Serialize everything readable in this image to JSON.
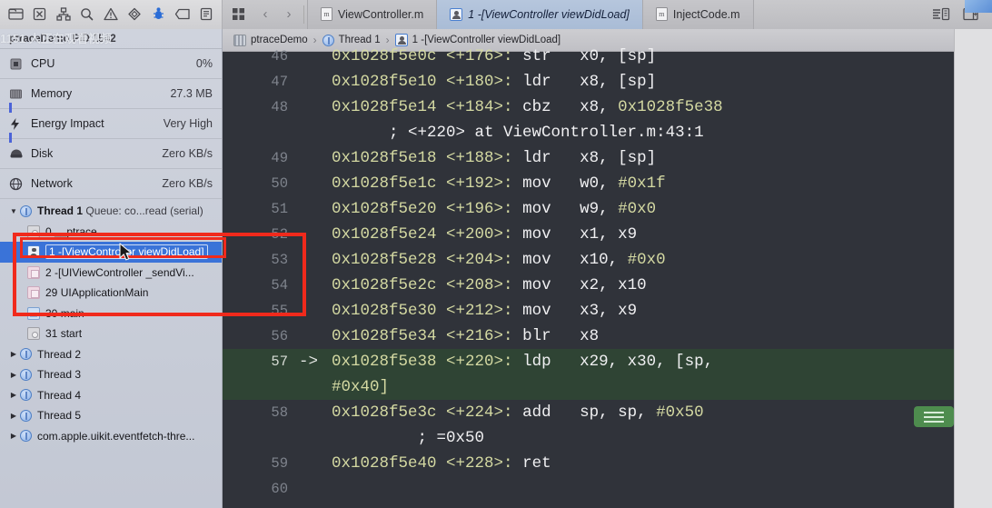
{
  "toolbar": {
    "nav_icons": [
      {
        "name": "project-navigator-icon",
        "glyph": "folder"
      },
      {
        "name": "source-control-navigator-icon",
        "glyph": "xbox"
      },
      {
        "name": "symbol-navigator-icon",
        "glyph": "hierarchy"
      },
      {
        "name": "find-navigator-icon",
        "glyph": "search"
      },
      {
        "name": "issue-navigator-icon",
        "glyph": "warning"
      },
      {
        "name": "test-navigator-icon",
        "glyph": "diamond"
      },
      {
        "name": "debug-navigator-icon",
        "glyph": "debug"
      },
      {
        "name": "breakpoint-navigator-icon",
        "glyph": "tag"
      },
      {
        "name": "report-navigator-icon",
        "glyph": "report"
      }
    ],
    "jump_bar_grid": "grid-icon",
    "back_arrow": "‹",
    "forward_arrow": "›",
    "tabs": [
      {
        "label": "ViewController.m",
        "icon": "m",
        "active": false
      },
      {
        "label": "1 -[ViewController viewDidLoad]",
        "icon": "frame",
        "active": true
      },
      {
        "label": "InjectCode.m",
        "icon": "m",
        "active": false
      }
    ],
    "right_buttons": [
      {
        "name": "assistant-editor-button",
        "label": "≡"
      },
      {
        "name": "inspector-toggle-button",
        "label": "▣"
      }
    ]
  },
  "sidebar": {
    "header": {
      "process": "ptraceDemo PID 1542",
      "watermark": "1151 人正在观看视频"
    },
    "gauges": [
      {
        "name": "cpu",
        "label": "CPU",
        "value": "0%",
        "icon": "cpu-icon",
        "spark": false
      },
      {
        "name": "memory",
        "label": "Memory",
        "value": "27.3 MB",
        "icon": "memory-icon",
        "spark": true
      },
      {
        "name": "energy",
        "label": "Energy Impact",
        "value": "Very High",
        "icon": "energy-icon",
        "spark": true
      },
      {
        "name": "disk",
        "label": "Disk",
        "value": "Zero KB/s",
        "icon": "disk-icon",
        "spark": false
      },
      {
        "name": "network",
        "label": "Network",
        "value": "Zero KB/s",
        "icon": "network-icon",
        "spark": false
      }
    ],
    "thread1": {
      "disclosure": "▼",
      "name": "Thread 1",
      "queue": "Queue: co...read (serial)"
    },
    "frames": [
      {
        "index": "0",
        "label": "__ptrace",
        "icon": "gray",
        "selected": false
      },
      {
        "index": "1",
        "label": "-[ViewController viewDidLoad]",
        "icon": "usr",
        "selected": true
      },
      {
        "index": "2",
        "label": "-[UIViewController _sendVi...",
        "icon": "pink",
        "selected": false
      },
      {
        "index": "29",
        "label": "UIApplicationMain",
        "icon": "pink",
        "selected": false
      },
      {
        "index": "30",
        "label": "main",
        "icon": "blue",
        "selected": false
      },
      {
        "index": "31",
        "label": "start",
        "icon": "gray",
        "selected": false
      }
    ],
    "other_threads": [
      {
        "disclosure": "▶",
        "name": "Thread 2",
        "queue": ""
      },
      {
        "disclosure": "▶",
        "name": "Thread 3",
        "queue": ""
      },
      {
        "disclosure": "▶",
        "name": "Thread 4",
        "queue": ""
      },
      {
        "disclosure": "▶",
        "name": "Thread 5",
        "queue": ""
      },
      {
        "disclosure": "▶",
        "name": "com.apple.uikit.eventfetch-thre...",
        "queue": ""
      }
    ]
  },
  "breadcrumb": {
    "project": "ptraceDemo",
    "thread": "Thread 1",
    "frame": "1 -[ViewController viewDidLoad]",
    "sep": "›"
  },
  "editor": {
    "assembly_badge": "assembly-toggle-badge",
    "lines": [
      {
        "num": "46",
        "ptr": "",
        "addr": "0x1028f5e0c",
        "off": "<+176>:",
        "mnem": "str",
        "ops": "x0, [sp]",
        "current": false,
        "partial_top": true
      },
      {
        "num": "47",
        "ptr": "",
        "addr": "0x1028f5e10",
        "off": "<+180>:",
        "mnem": "ldr",
        "ops": "x8, [sp]",
        "current": false
      },
      {
        "num": "48",
        "ptr": "",
        "addr": "0x1028f5e14",
        "off": "<+184>:",
        "mnem": "cbz",
        "ops": "x8, ",
        "imm": "0x1028f5e38",
        "current": false
      },
      {
        "num": "",
        "ptr": "",
        "comment": "; <+220> at ViewController.m:43:1",
        "continuation": true
      },
      {
        "num": "49",
        "ptr": "",
        "addr": "0x1028f5e18",
        "off": "<+188>:",
        "mnem": "ldr",
        "ops": "x8, [sp]",
        "current": false
      },
      {
        "num": "50",
        "ptr": "",
        "addr": "0x1028f5e1c",
        "off": "<+192>:",
        "mnem": "mov",
        "ops": "w0, ",
        "imm": "#0x1f",
        "current": false
      },
      {
        "num": "51",
        "ptr": "",
        "addr": "0x1028f5e20",
        "off": "<+196>:",
        "mnem": "mov",
        "ops": "w9, ",
        "imm": "#0x0",
        "current": false
      },
      {
        "num": "52",
        "ptr": "",
        "addr": "0x1028f5e24",
        "off": "<+200>:",
        "mnem": "mov",
        "ops": "x1, x9",
        "current": false
      },
      {
        "num": "53",
        "ptr": "",
        "addr": "0x1028f5e28",
        "off": "<+204>:",
        "mnem": "mov",
        "ops": "x10, ",
        "imm": "#0x0",
        "current": false
      },
      {
        "num": "54",
        "ptr": "",
        "addr": "0x1028f5e2c",
        "off": "<+208>:",
        "mnem": "mov",
        "ops": "x2, x10",
        "current": false
      },
      {
        "num": "55",
        "ptr": "",
        "addr": "0x1028f5e30",
        "off": "<+212>:",
        "mnem": "mov",
        "ops": "x3, x9",
        "current": false
      },
      {
        "num": "56",
        "ptr": "",
        "addr": "0x1028f5e34",
        "off": "<+216>:",
        "mnem": "blr",
        "ops": "x8",
        "current": false
      },
      {
        "num": "57",
        "ptr": "->",
        "addr": "0x1028f5e38",
        "off": "<+220>:",
        "mnem": "ldp",
        "ops": "x29, x30, [sp,",
        "current": true
      },
      {
        "num": "",
        "ptr": "",
        "imm": "#0x40]",
        "current": true,
        "continuation": true
      },
      {
        "num": "58",
        "ptr": "",
        "addr": "0x1028f5e3c",
        "off": "<+224>:",
        "mnem": "add",
        "ops": "sp, sp, ",
        "imm": "#0x50",
        "current": false
      },
      {
        "num": "",
        "ptr": "",
        "comment": "; =0x50",
        "continuation": true
      },
      {
        "num": "59",
        "ptr": "",
        "addr": "0x1028f5e40",
        "off": "<+228>:",
        "mnem": "ret",
        "ops": "",
        "current": false
      },
      {
        "num": "60",
        "ptr": "",
        "addr": "",
        "off": "",
        "mnem": "",
        "ops": "",
        "current": false
      }
    ]
  },
  "annotations": {
    "outer_box_color": "#f02a1c",
    "inner_box_color": "#f02a1c"
  },
  "colors": {
    "code_bg": "#30333a",
    "current_line_bg": "#2f4434",
    "address": "#d4d9a2",
    "selection_blue": "#3a73d8",
    "badge_green": "#4e8c4e"
  }
}
